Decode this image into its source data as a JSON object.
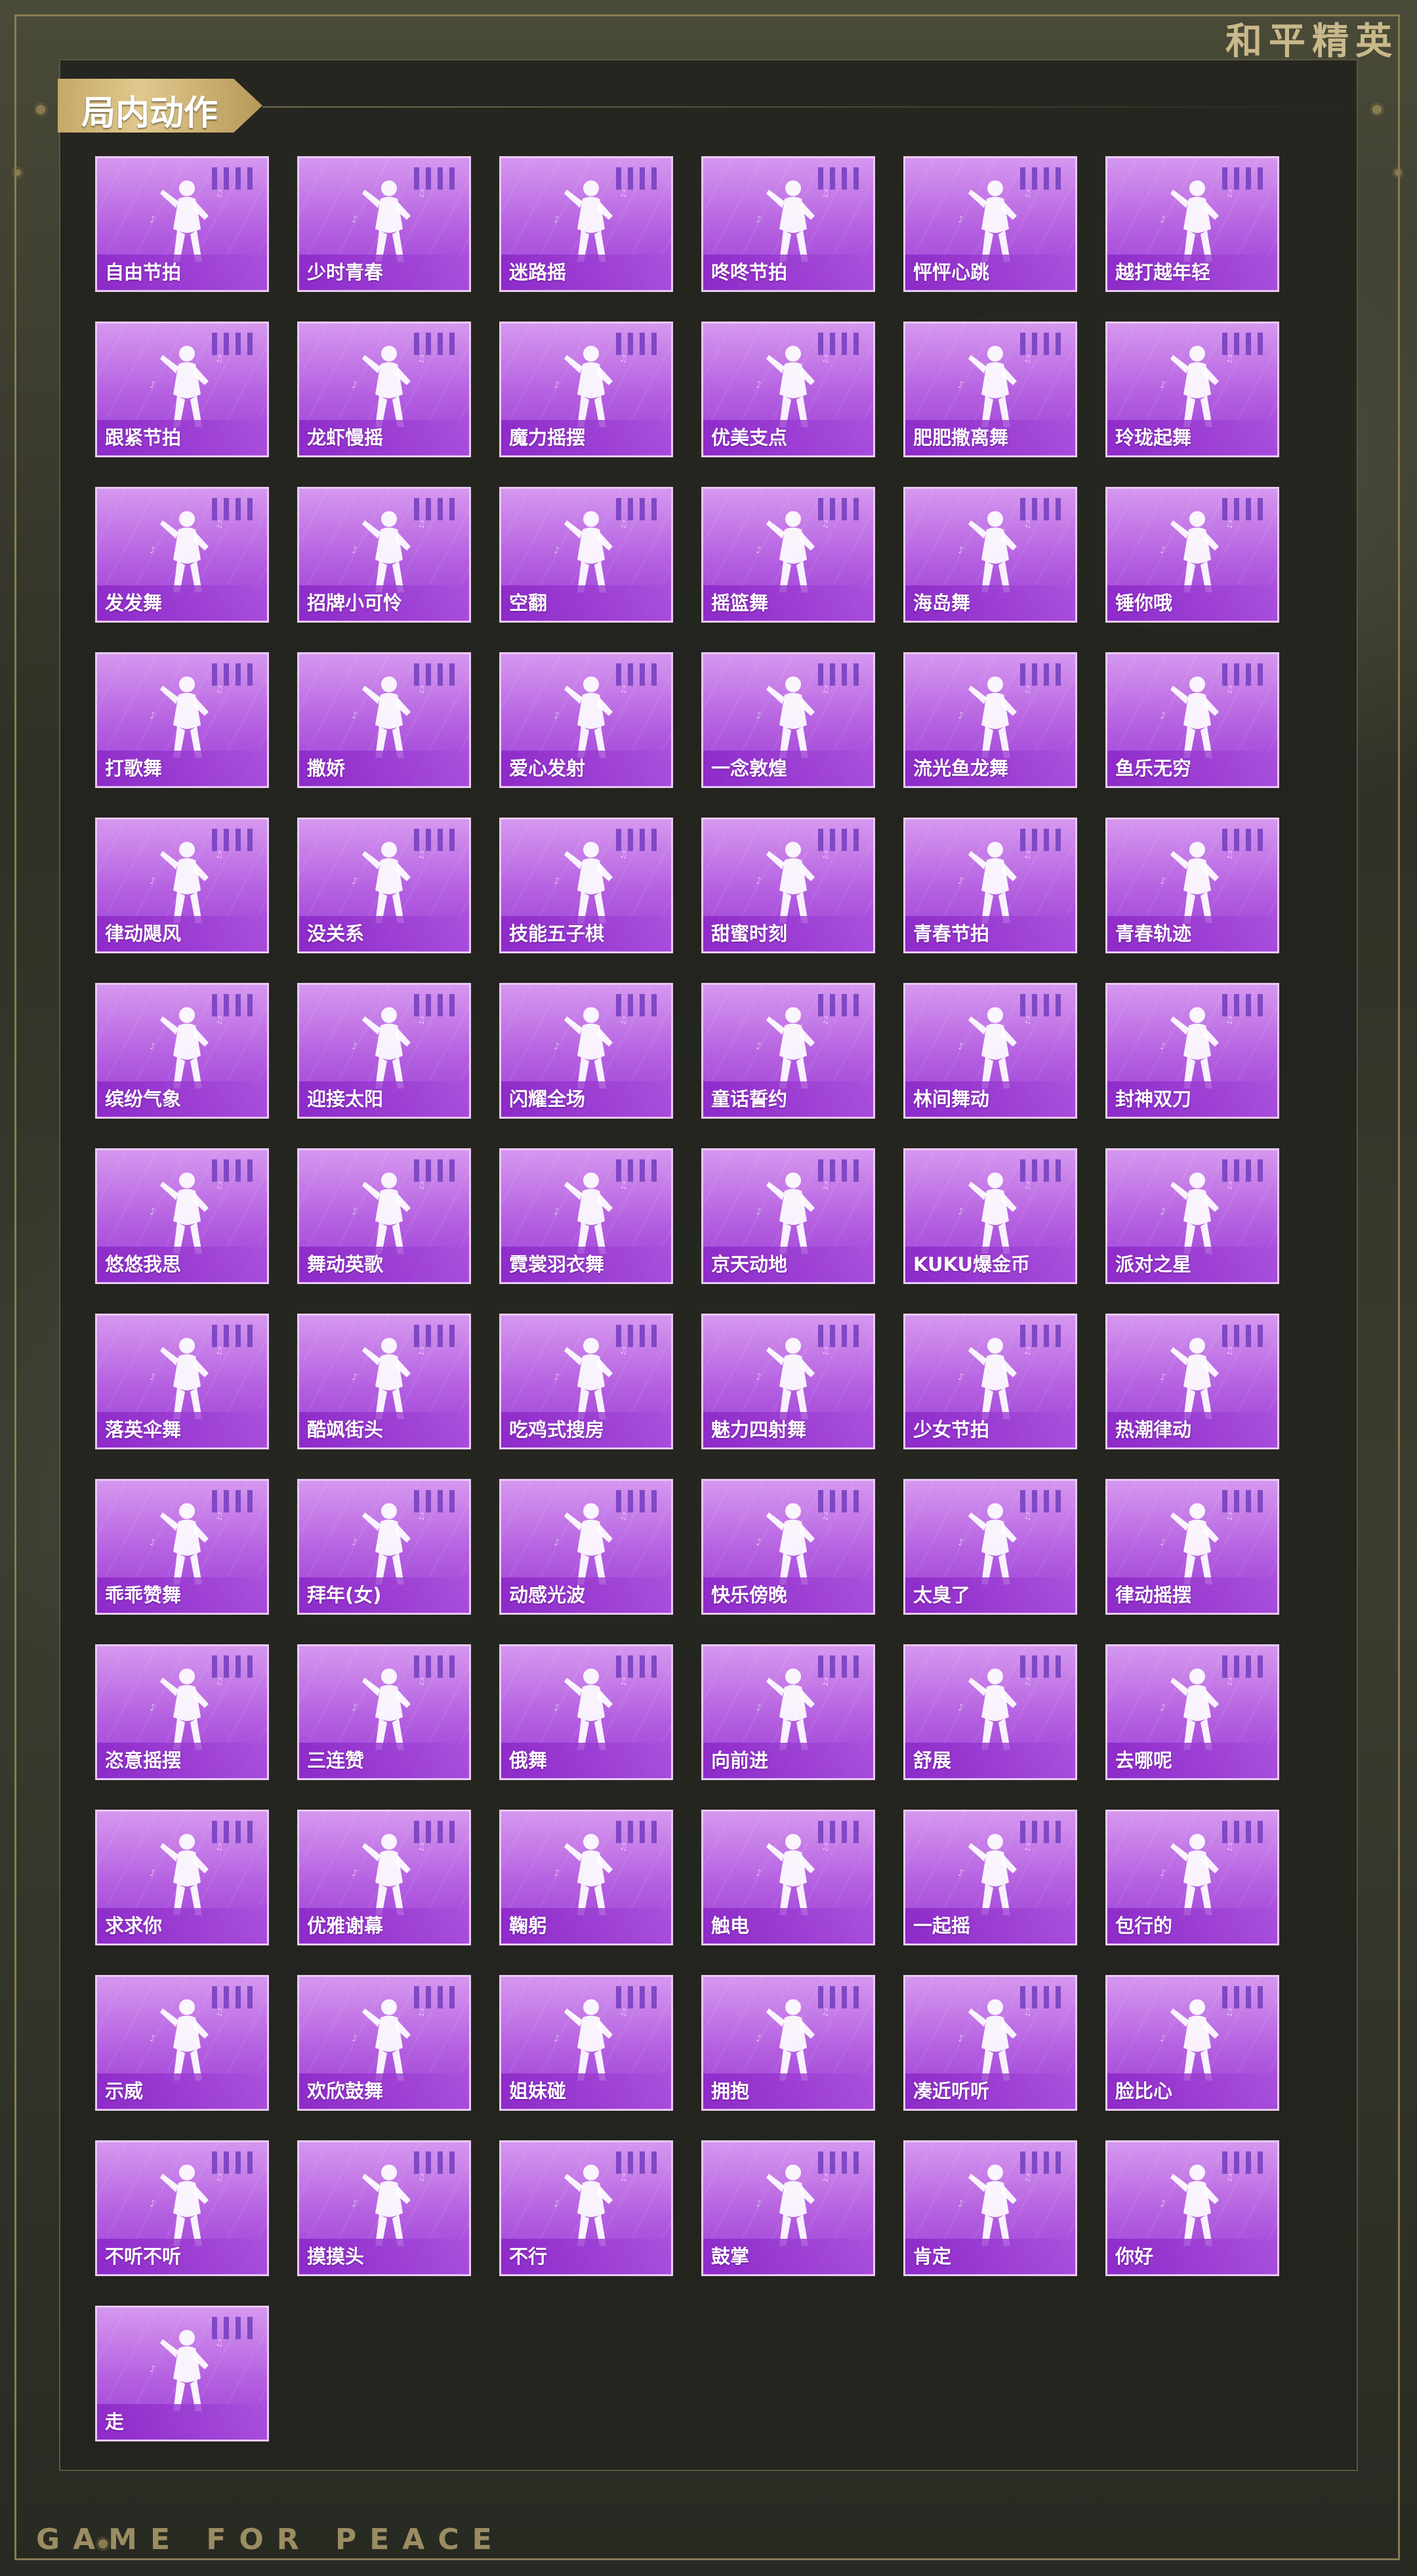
{
  "header": {
    "brand": "和平精英"
  },
  "footer": {
    "brand": "GAME FOR PEACE"
  },
  "section": {
    "title": "局内动作"
  },
  "emotes": [
    {
      "label": "自由节拍"
    },
    {
      "label": "少时青春"
    },
    {
      "label": "迷路摇"
    },
    {
      "label": "咚咚节拍"
    },
    {
      "label": "怦怦心跳"
    },
    {
      "label": "越打越年轻"
    },
    {
      "label": "跟紧节拍"
    },
    {
      "label": "龙虾慢摇"
    },
    {
      "label": "魔力摇摆"
    },
    {
      "label": "优美支点"
    },
    {
      "label": "肥肥撒离舞"
    },
    {
      "label": "玲珑起舞"
    },
    {
      "label": "发发舞"
    },
    {
      "label": "招牌小可怜"
    },
    {
      "label": "空翻"
    },
    {
      "label": "摇篮舞"
    },
    {
      "label": "海岛舞"
    },
    {
      "label": "锤你哦"
    },
    {
      "label": "打歌舞"
    },
    {
      "label": "撒娇"
    },
    {
      "label": "爱心发射"
    },
    {
      "label": "一念敦煌"
    },
    {
      "label": "流光鱼龙舞"
    },
    {
      "label": "鱼乐无穷"
    },
    {
      "label": "律动飓风"
    },
    {
      "label": "没关系"
    },
    {
      "label": "技能五子棋"
    },
    {
      "label": "甜蜜时刻"
    },
    {
      "label": "青春节拍"
    },
    {
      "label": "青春轨迹"
    },
    {
      "label": "缤纷气象"
    },
    {
      "label": "迎接太阳"
    },
    {
      "label": "闪耀全场"
    },
    {
      "label": "童话誓约"
    },
    {
      "label": "林间舞动"
    },
    {
      "label": "封神双刀"
    },
    {
      "label": "悠悠我思"
    },
    {
      "label": "舞动英歌"
    },
    {
      "label": "霓裳羽衣舞"
    },
    {
      "label": "京天动地"
    },
    {
      "label": "KUKU爆金币"
    },
    {
      "label": "派对之星"
    },
    {
      "label": "落英伞舞"
    },
    {
      "label": "酷飒街头"
    },
    {
      "label": "吃鸡式搜房"
    },
    {
      "label": "魅力四射舞"
    },
    {
      "label": "少女节拍"
    },
    {
      "label": "热潮律动"
    },
    {
      "label": "乖乖赞舞"
    },
    {
      "label": "拜年(女)"
    },
    {
      "label": "动感光波"
    },
    {
      "label": "快乐傍晚"
    },
    {
      "label": "太臭了"
    },
    {
      "label": "律动摇摆"
    },
    {
      "label": "恣意摇摆"
    },
    {
      "label": "三连赞"
    },
    {
      "label": "俄舞"
    },
    {
      "label": "向前进"
    },
    {
      "label": "舒展"
    },
    {
      "label": "去哪呢"
    },
    {
      "label": "求求你"
    },
    {
      "label": "优雅谢幕"
    },
    {
      "label": "鞠躬"
    },
    {
      "label": "触电"
    },
    {
      "label": "一起摇"
    },
    {
      "label": "包行的"
    },
    {
      "label": "示威"
    },
    {
      "label": "欢欣鼓舞"
    },
    {
      "label": "姐妹碰"
    },
    {
      "label": "拥抱"
    },
    {
      "label": "凑近听听"
    },
    {
      "label": "脸比心"
    },
    {
      "label": "不听不听"
    },
    {
      "label": "摸摸头"
    },
    {
      "label": "不行"
    },
    {
      "label": "鼓掌"
    },
    {
      "label": "肯定"
    },
    {
      "label": "你好"
    },
    {
      "label": "走"
    }
  ],
  "colors": {
    "card_top": "#d597ef",
    "card_bottom": "#9a3fd6",
    "card_border": "#e9c9f4",
    "gold": "#c9b98a"
  }
}
